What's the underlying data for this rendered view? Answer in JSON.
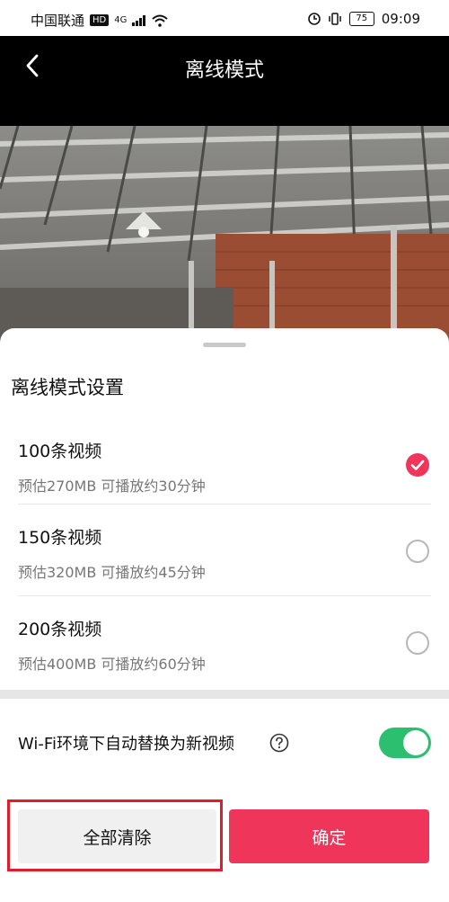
{
  "status_bar": {
    "carrier": "中国联通",
    "network_badge": "HD",
    "network_type": "4G",
    "wifi_icon": "wifi-icon",
    "battery": "75",
    "time": "09:09"
  },
  "header": {
    "title": "离线模式",
    "back_icon": "chevron-left-icon"
  },
  "sheet": {
    "title": "离线模式设置",
    "options": [
      {
        "label": "100条视频",
        "desc": "预估270MB 可播放约30分钟",
        "selected": true
      },
      {
        "label": "150条视频",
        "desc": "预估320MB 可播放约45分钟",
        "selected": false
      },
      {
        "label": "200条视频",
        "desc": "预估400MB 可播放约60分钟",
        "selected": false
      }
    ],
    "wifi_setting": {
      "label": "Wi-Fi环境下自动替换为新视频",
      "enabled": true
    },
    "buttons": {
      "clear": "全部清除",
      "confirm": "确定"
    }
  },
  "colors": {
    "accent": "#f0355b",
    "toggle_on": "#2bbf6f",
    "highlight": "#e01e2b"
  }
}
